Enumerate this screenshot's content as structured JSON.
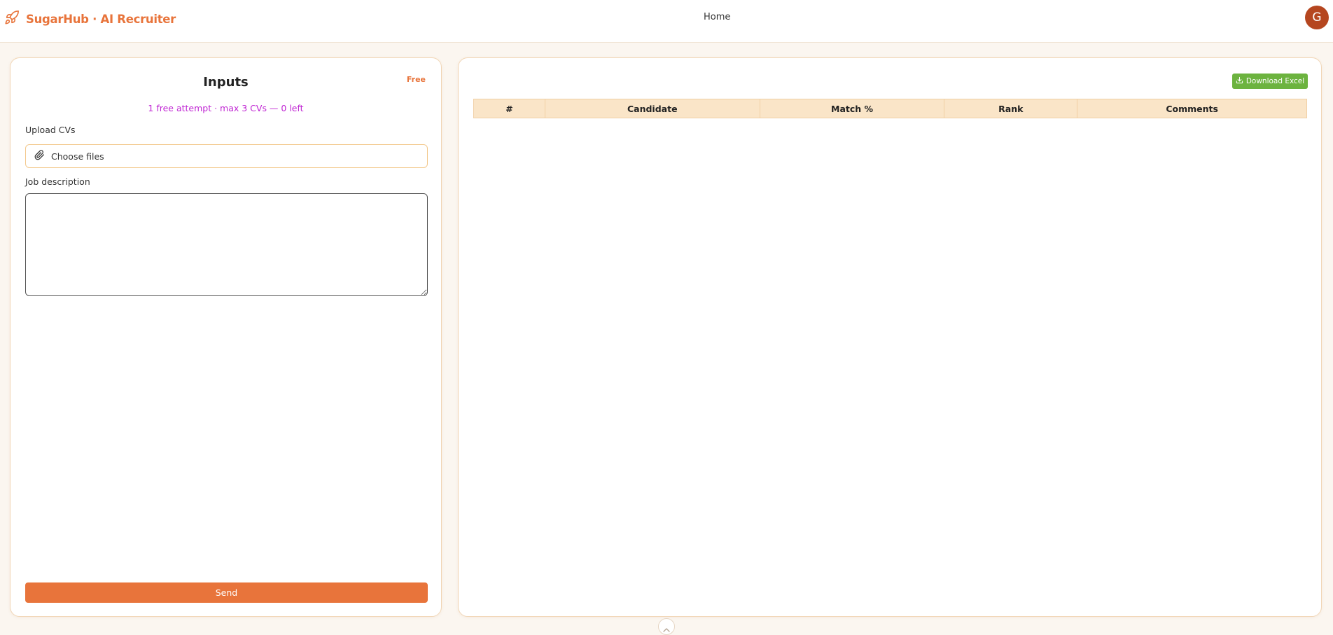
{
  "header": {
    "brand": "SugarHub · AI Recruiter",
    "brand_icon": "rocket-icon",
    "nav_home": "Home",
    "avatar_initial": "G"
  },
  "colors": {
    "accent": "#e8743b",
    "attempts_text": "#c026d3",
    "download_button": "#6cb33f",
    "avatar_bg": "#b5461f",
    "table_header_bg": "#fae5c8"
  },
  "inputs_panel": {
    "title": "Inputs",
    "plan_badge": "Free",
    "attempts_note": "1 free attempt · max 3 CVs — 0 left",
    "upload_label": "Upload CVs",
    "upload_button": "Choose files",
    "upload_icon": "paperclip-icon",
    "job_description_label": "Job description",
    "job_description_value": "",
    "send_label": "Send"
  },
  "results_panel": {
    "download_label": "Download Excel",
    "download_icon": "download-icon",
    "columns": [
      "#",
      "Candidate",
      "Match %",
      "Rank",
      "Comments"
    ],
    "rows": []
  }
}
